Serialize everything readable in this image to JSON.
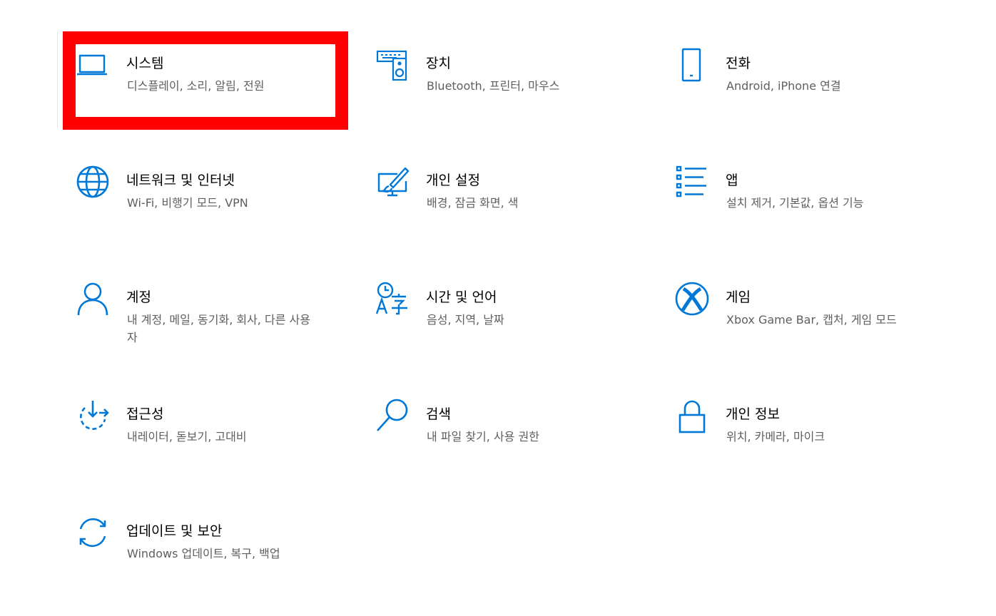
{
  "accent_color": "#0078d7",
  "highlight_color": "#ff0000",
  "tiles": [
    {
      "icon": "laptop-icon",
      "title": "시스템",
      "desc": "디스플레이, 소리, 알림, 전원"
    },
    {
      "icon": "device-icon",
      "title": "장치",
      "desc": "Bluetooth, 프린터, 마우스"
    },
    {
      "icon": "phone-icon",
      "title": "전화",
      "desc": "Android, iPhone 연결"
    },
    {
      "icon": "globe-icon",
      "title": "네트워크 및 인터넷",
      "desc": "Wi-Fi, 비행기 모드, VPN"
    },
    {
      "icon": "personalization-icon",
      "title": "개인 설정",
      "desc": "배경, 잠금 화면, 색"
    },
    {
      "icon": "apps-list-icon",
      "title": "앱",
      "desc": "설치 제거, 기본값, 옵션 기능"
    },
    {
      "icon": "person-icon",
      "title": "계정",
      "desc": "내 계정, 메일, 동기화, 회사, 다른 사용자"
    },
    {
      "icon": "time-language-icon",
      "title": "시간 및 언어",
      "desc": "음성, 지역, 날짜"
    },
    {
      "icon": "xbox-icon",
      "title": "게임",
      "desc": "Xbox Game Bar, 캡처, 게임 모드"
    },
    {
      "icon": "accessibility-icon",
      "title": "접근성",
      "desc": "내레이터, 돋보기, 고대비"
    },
    {
      "icon": "search-icon",
      "title": "검색",
      "desc": "내 파일 찾기, 사용 권한"
    },
    {
      "icon": "lock-icon",
      "title": "개인 정보",
      "desc": "위치, 카메라, 마이크"
    },
    {
      "icon": "sync-icon",
      "title": "업데이트 및 보안",
      "desc": "Windows 업데이트, 복구, 백업"
    }
  ]
}
